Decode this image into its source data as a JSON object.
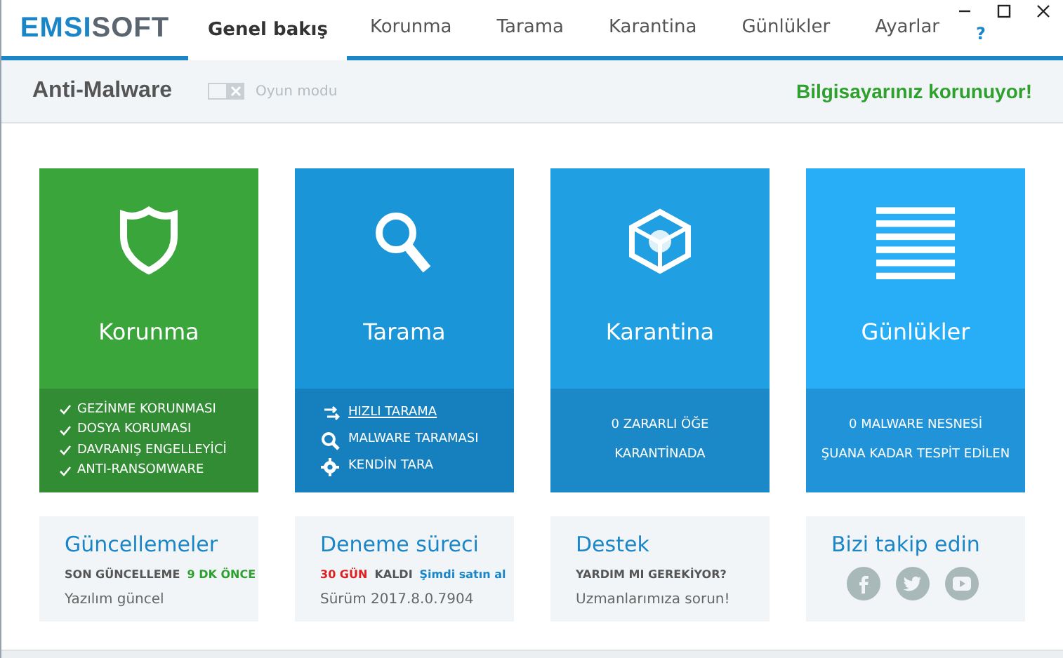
{
  "logo": {
    "part_1": "EMSI",
    "part_2": "SOFT"
  },
  "tabs": [
    {
      "label": "Genel bakış",
      "selected": true
    },
    {
      "label": "Korunma",
      "selected": false
    },
    {
      "label": "Tarama",
      "selected": false
    },
    {
      "label": "Karantina",
      "selected": false
    },
    {
      "label": "Günlükler",
      "selected": false
    },
    {
      "label": "Ayarlar",
      "selected": false
    }
  ],
  "help": "?",
  "subheader": {
    "title": "Anti-Malware",
    "game_mode": {
      "label": "Oyun modu",
      "on": false
    },
    "status": "Bilgisayarınız korunuyor!"
  },
  "tiles": [
    {
      "title": "Korunma",
      "color": "#3aa53a",
      "kind": "checklist",
      "items": [
        {
          "text": "GEZİNME KORUNMASI"
        },
        {
          "text": "DOSYA KORUMASI"
        },
        {
          "text": "DAVRANIŞ ENGELLEYİCİ"
        },
        {
          "text": "ANTI-RANSOMWARE"
        }
      ]
    },
    {
      "title": "Tarama",
      "color": "#1a96d8",
      "kind": "actions",
      "items": [
        {
          "text": "HIZLI TARAMA",
          "underlined": true
        },
        {
          "text": "MALWARE TARAMASI",
          "underlined": false
        },
        {
          "text": "KENDİN TARA",
          "underlined": false
        }
      ]
    },
    {
      "title": "Karantina",
      "color": "#20a0e3",
      "kind": "info",
      "items": [
        {
          "text": "0 ZARARLI ÖĞE"
        },
        {
          "text": "KARANTİNADA"
        }
      ]
    },
    {
      "title": "Günlükler",
      "color": "#27aef7",
      "kind": "info",
      "items": [
        {
          "text": "0 MALWARE NESNESİ"
        },
        {
          "text": "ŞUANA KADAR TESPİT EDİLEN"
        }
      ]
    }
  ],
  "cards": [
    {
      "title": "Güncellemeler",
      "kind": "text",
      "lines": [
        [
          {
            "text": "SON GÜNCELLEME",
            "kind": "label"
          },
          {
            "text": "9 DK ÖNCE",
            "kind": "good"
          }
        ],
        [
          {
            "text": "Yazılım güncel",
            "kind": "plain"
          }
        ]
      ]
    },
    {
      "title": "Deneme süreci",
      "kind": "text",
      "lines": [
        [
          {
            "text": "30 GÜN",
            "kind": "alert"
          },
          {
            "text": "KALDI",
            "kind": "label"
          },
          {
            "text": "Şimdi satın al",
            "kind": "link"
          }
        ],
        [
          {
            "text": "Sürüm 2017.8.0.7904",
            "kind": "plain"
          }
        ]
      ]
    },
    {
      "title": "Destek",
      "kind": "text",
      "lines": [
        [
          {
            "text": "YARDIM MI GEREKİYOR?",
            "kind": "label"
          }
        ],
        [
          {
            "text": "Uzmanlarımıza sorun!",
            "kind": "plain"
          }
        ]
      ]
    },
    {
      "title": "Bizi takip edin",
      "kind": "social"
    }
  ]
}
